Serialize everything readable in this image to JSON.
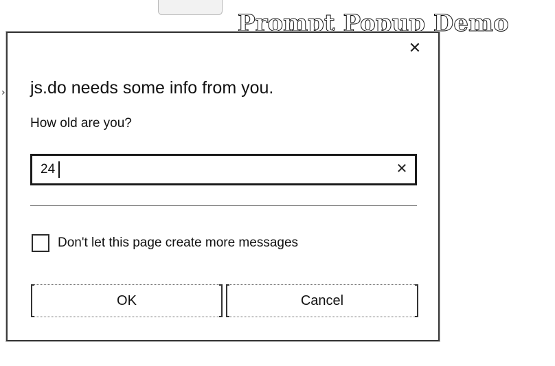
{
  "background_page": {
    "title": "Prompt Popup Demo",
    "arrow_glyph": "›"
  },
  "dialog": {
    "heading": "js.do needs some info from you.",
    "question": "How old are you?",
    "input": {
      "value": "24",
      "placeholder": ""
    },
    "close_icon": "close-icon",
    "clear_icon": "clear-icon",
    "checkbox": {
      "label": "Don't let this page create more messages",
      "checked": false
    },
    "buttons": {
      "ok_label": "OK",
      "cancel_label": "Cancel"
    }
  }
}
